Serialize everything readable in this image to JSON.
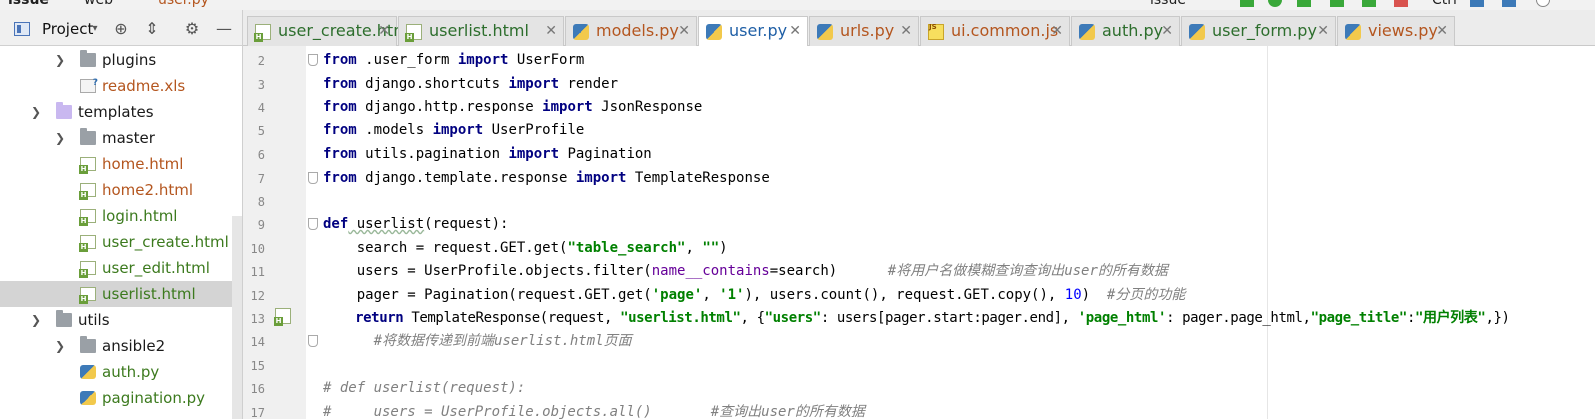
{
  "topbar": {
    "breadcrumb_issue": "issue",
    "breadcrumb_web": "web",
    "breadcrumb_file": "user.py",
    "run_config": "issue",
    "search_hint": "Ctrl"
  },
  "project_panel": {
    "title": "Project",
    "tree": [
      {
        "label": "plugins",
        "type": "folder",
        "expanded": false,
        "color": "default"
      },
      {
        "label": "readme.xls",
        "type": "xls",
        "color": "orange"
      },
      {
        "label": "templates",
        "type": "folder-purple",
        "expanded": true,
        "color": "default"
      },
      {
        "label": "master",
        "type": "folder",
        "expanded": false,
        "color": "default"
      },
      {
        "label": "home.html",
        "type": "html",
        "color": "orange"
      },
      {
        "label": "home2.html",
        "type": "html",
        "color": "orange"
      },
      {
        "label": "login.html",
        "type": "html",
        "color": "green"
      },
      {
        "label": "user_create.html",
        "type": "html",
        "color": "green"
      },
      {
        "label": "user_edit.html",
        "type": "html",
        "color": "green"
      },
      {
        "label": "userlist.html",
        "type": "html",
        "color": "green",
        "selected": true
      },
      {
        "label": "utils",
        "type": "folder",
        "expanded": true,
        "color": "default"
      },
      {
        "label": "ansible2",
        "type": "folder",
        "expanded": false,
        "color": "default"
      },
      {
        "label": "auth.py",
        "type": "py",
        "color": "green"
      },
      {
        "label": "pagination.py",
        "type": "py",
        "color": "green"
      }
    ]
  },
  "tabs": [
    {
      "label": "user_create.html",
      "icon": "html",
      "color": "green",
      "active": false
    },
    {
      "label": "userlist.html",
      "icon": "html",
      "color": "green",
      "active": false
    },
    {
      "label": "models.py",
      "icon": "py",
      "color": "orange",
      "active": false
    },
    {
      "label": "user.py",
      "icon": "py",
      "color": "blue",
      "active": true
    },
    {
      "label": "urls.py",
      "icon": "py",
      "color": "orange",
      "active": false
    },
    {
      "label": "ui.common.js",
      "icon": "js",
      "color": "orange",
      "active": false
    },
    {
      "label": "auth.py",
      "icon": "py",
      "color": "green",
      "active": false
    },
    {
      "label": "user_form.py",
      "icon": "py",
      "color": "green",
      "active": false
    },
    {
      "label": "views.py",
      "icon": "py",
      "color": "orange",
      "active": false
    }
  ],
  "editor": {
    "line_numbers": [
      "2",
      "3",
      "4",
      "5",
      "6",
      "7",
      "8",
      "9",
      "10",
      "11",
      "12",
      "13",
      "14",
      "15",
      "16",
      "17"
    ],
    "lines": {
      "l2": {
        "kw1": "from",
        "a": " .user_form ",
        "kw2": "import",
        "b": " UserForm"
      },
      "l3": {
        "kw1": "from",
        "a": " django.shortcuts ",
        "kw2": "import",
        "b": " render"
      },
      "l4": {
        "kw1": "from",
        "a": " django.http.response ",
        "kw2": "import",
        "b": " JsonResponse"
      },
      "l5": {
        "kw1": "from",
        "a": " .models ",
        "kw2": "import",
        "b": " UserProfile"
      },
      "l6": {
        "kw1": "from",
        "a": " utils.pagination ",
        "kw2": "import",
        "b": " Pagination"
      },
      "l7": {
        "kw1": "from",
        "a": " django.template.response ",
        "kw2": "import",
        "b": " TemplateResponse"
      },
      "l9": {
        "kw": "def",
        "name": " userlist",
        "rest": "(request):"
      },
      "l10": {
        "a": "    search = request.GET.get(",
        "s1": "\"table_search\"",
        "b": ", ",
        "s2": "\"\"",
        "c": ")"
      },
      "l11": {
        "a": "    users = UserProfile.objects.filter(",
        "p": "name__contains",
        "b": "=search)      ",
        "cmt": "#将用户名做模糊查询查询出user的所有数据"
      },
      "l12": {
        "a": "    pager = Pagination(request.GET.get(",
        "s1": "'page'",
        "b": ", ",
        "s2": "'1'",
        "c": "), users.count(), request.GET.copy(), ",
        "n": "10",
        "d": ")  ",
        "cmt": "#分页的功能"
      },
      "l13": {
        "kw": "    return",
        "a": " TemplateResponse(request, ",
        "s1": "\"userlist.html\"",
        "b": ", {",
        "s2": "\"users\"",
        "c": ": users[pager.start:pager.end], ",
        "s3": "'page_html'",
        "d": ": pager.page_html,",
        "s4": "\"page_title\"",
        "e": ":",
        "s5": "\"用户列表\"",
        "f": ",})"
      },
      "l14": {
        "cmt": "      #将数据传递到前端userlist.html页面"
      },
      "l16": {
        "cmt": "# def userlist(request):"
      },
      "l17": {
        "cmt": "#     users = UserProfile.objects.all()       #查询出user的所有数据"
      }
    }
  }
}
